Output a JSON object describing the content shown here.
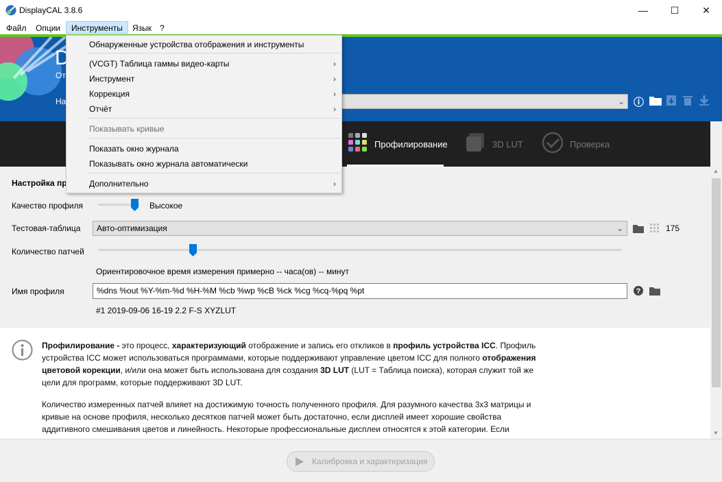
{
  "window": {
    "title": "DisplayCAL 3.8.6",
    "minimize": "—",
    "maximize": "☐",
    "close": "✕"
  },
  "menubar": [
    "Файл",
    "Опции",
    "Инструменты",
    "Язык",
    "?"
  ],
  "header": {
    "title_partial": "D",
    "subtitle_partial": "От",
    "display_label_partial": "На",
    "display_value": ""
  },
  "tabs": [
    {
      "label": "Профилирование",
      "active": true
    },
    {
      "label": "3D LUT"
    },
    {
      "label": "Проверка"
    }
  ],
  "settings": {
    "section_title": "Настройка пр",
    "quality_label": "Качество профиля",
    "quality_value": "Высокое",
    "quality_level": 0.75,
    "testchart_label": "Тестовая-таблица",
    "testchart_value": "Авто-оптимизация",
    "patch_count": "175",
    "patches_label": "Количество патчей",
    "patches_level": 0.12,
    "estimate": "Ориентировочное время измерения примерно -- часа(ов) -- минут",
    "profile_name_label": "Имя профиля",
    "profile_name_value": "%dns %out %Y-%m-%d %H-%M %cb %wp %cB %ck %cg %cq-%pq %pt",
    "profile_name_preview": "#1 2019-09-06 16-19 2.2 F-S XYZLUT"
  },
  "info": {
    "p1": [
      {
        "t": "Профилирование -",
        "b": true
      },
      {
        "t": " это процесс, "
      },
      {
        "t": "характеризующий",
        "b": true
      },
      {
        "t": " отображение и запись его откликов в "
      },
      {
        "t": "профиль устройства ICC",
        "b": true
      },
      {
        "t": ". Профиль устройства ICC может использоваться программами, которые поддерживают управление цветом ICC для полного "
      },
      {
        "t": "отображения цветовой корекции",
        "b": true
      },
      {
        "t": ", и/или она может быть использована для создания "
      },
      {
        "t": "3D LUT",
        "b": true
      },
      {
        "t": " (LUT = Таблица поиска), которая служит той же цели для программ, которые поддерживают 3D LUT."
      }
    ],
    "p2": "Количество измеренных патчей влияет на достижимую точность полученного профиля. Для разумного качества 3x3 матрицы и кривые на основе профиля, несколько десятков патчей может быть достаточно, если дисплей имеет хорошие свойства аддитивного смешивания цветов и линейность. Некоторые профессиональные дисплеи относятся к этой категории. Если"
  },
  "run_button": "Калибровка и характеризация",
  "menu": {
    "items": [
      {
        "label": "Обнаруженные устройства отображения и инструменты"
      },
      {
        "label": "(VCGT) Таблица гаммы видео-карты",
        "submenu": "›"
      },
      {
        "label": "Инструмент",
        "submenu": "›"
      },
      {
        "label": "Коррекция",
        "submenu": "›"
      },
      {
        "label": "Отчёт",
        "submenu": "›"
      },
      {
        "label": "Показывать кривые",
        "disabled": true
      },
      {
        "label": "Показать окно журнала"
      },
      {
        "label": "Показывать окно журнала автоматически"
      },
      {
        "label": "Дополнительно",
        "submenu": "›"
      }
    ]
  },
  "colors": {
    "header_blue": "#0f5aab",
    "accent_green": "#64c323",
    "tab_bar": "#202020",
    "slider": "#0078d7"
  }
}
